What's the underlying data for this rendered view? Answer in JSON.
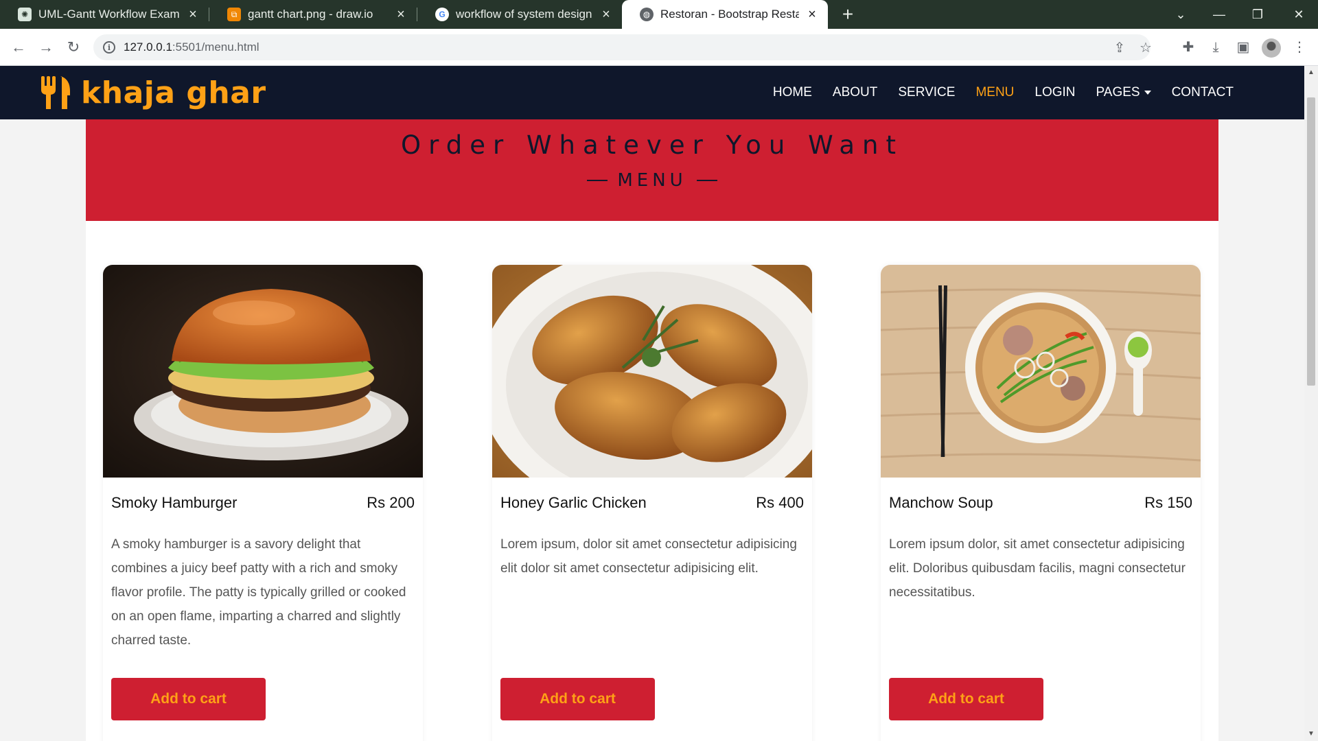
{
  "browser": {
    "tabs": [
      {
        "title": "UML-Gantt Workflow Example",
        "active": false,
        "icon": "chatgpt-icon"
      },
      {
        "title": "gantt chart.png - draw.io",
        "active": false,
        "icon": "drawio-icon"
      },
      {
        "title": "workflow of system design using",
        "active": false,
        "icon": "google-icon"
      },
      {
        "title": "Restoran - Bootstrap Restaurant",
        "active": true,
        "icon": "globe-icon"
      }
    ],
    "url_host": "127.0.0.1",
    "url_rest": ":5501/menu.html"
  },
  "site": {
    "brand": "khaja ghar",
    "nav": [
      "HOME",
      "ABOUT",
      "SERVICE",
      "MENU",
      "LOGIN",
      "PAGES",
      "CONTACT"
    ],
    "active_nav": "MENU"
  },
  "hero": {
    "title": "Order Whatever You Want",
    "subtitle": "MENU"
  },
  "menu_items": [
    {
      "name": "Smoky Hamburger",
      "price": "Rs 200",
      "description": "A smoky hamburger is a savory delight that combines a juicy beef patty with a rich and smoky flavor profile. The patty is typically grilled or cooked on an open flame, imparting a charred and slightly charred taste.",
      "button": "Add to cart"
    },
    {
      "name": "Honey Garlic Chicken",
      "price": "Rs 400",
      "description": "Lorem ipsum, dolor sit amet consectetur adipisicing elit dolor sit amet consectetur adipisicing elit.",
      "button": "Add to cart"
    },
    {
      "name": "Manchow Soup",
      "price": "Rs 150",
      "description": "Lorem ipsum dolor, sit amet consectetur adipisicing elit. Doloribus quibusdam facilis, magni consectetur necessitatibus.",
      "button": "Add to cart"
    }
  ],
  "colors": {
    "primary": "#fea116",
    "dark": "#0f172b",
    "accent_red": "#ce1f31"
  }
}
